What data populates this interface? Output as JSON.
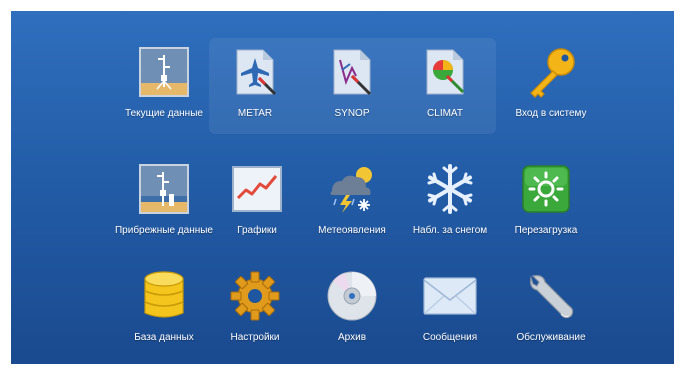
{
  "rows": [
    [
      {
        "key": "current",
        "label": "Текущие данные",
        "icon": "weather-station-icon"
      },
      {
        "key": "metar",
        "label": "METAR",
        "icon": "metar-document-icon"
      },
      {
        "key": "synop",
        "label": "SYNOP",
        "icon": "synop-document-icon"
      },
      {
        "key": "climat",
        "label": "CLIMAT",
        "icon": "climat-document-icon"
      },
      {
        "key": "login",
        "label": "Вход в систему",
        "icon": "key-icon"
      }
    ],
    [
      {
        "key": "coastal",
        "label": "Прибрежные данные",
        "icon": "coastal-station-icon"
      },
      {
        "key": "charts",
        "label": "Графики",
        "icon": "chart-icon"
      },
      {
        "key": "meteo",
        "label": "Метеоявления",
        "icon": "storm-snow-icon"
      },
      {
        "key": "snow",
        "label": "Набл. за снегом",
        "icon": "snowflake-icon"
      },
      {
        "key": "reboot",
        "label": "Перезагрузка",
        "icon": "reboot-icon"
      }
    ],
    [
      {
        "key": "db",
        "label": "База данных",
        "icon": "database-icon"
      },
      {
        "key": "settings",
        "label": "Настройки",
        "icon": "gear-icon"
      },
      {
        "key": "archive",
        "label": "Архив",
        "icon": "disc-icon"
      },
      {
        "key": "messages",
        "label": "Сообщения",
        "icon": "envelope-icon"
      },
      {
        "key": "service",
        "label": "Обслуживание",
        "icon": "wrench-icon"
      }
    ]
  ],
  "colors": {
    "background_top": "#2f6fbd",
    "background_bottom": "#1a4a8f",
    "label": "#ffffff",
    "key": "#f2b416",
    "reboot": "#3aa83a",
    "database": "#f4c51c",
    "gear": "#e09a1c"
  }
}
